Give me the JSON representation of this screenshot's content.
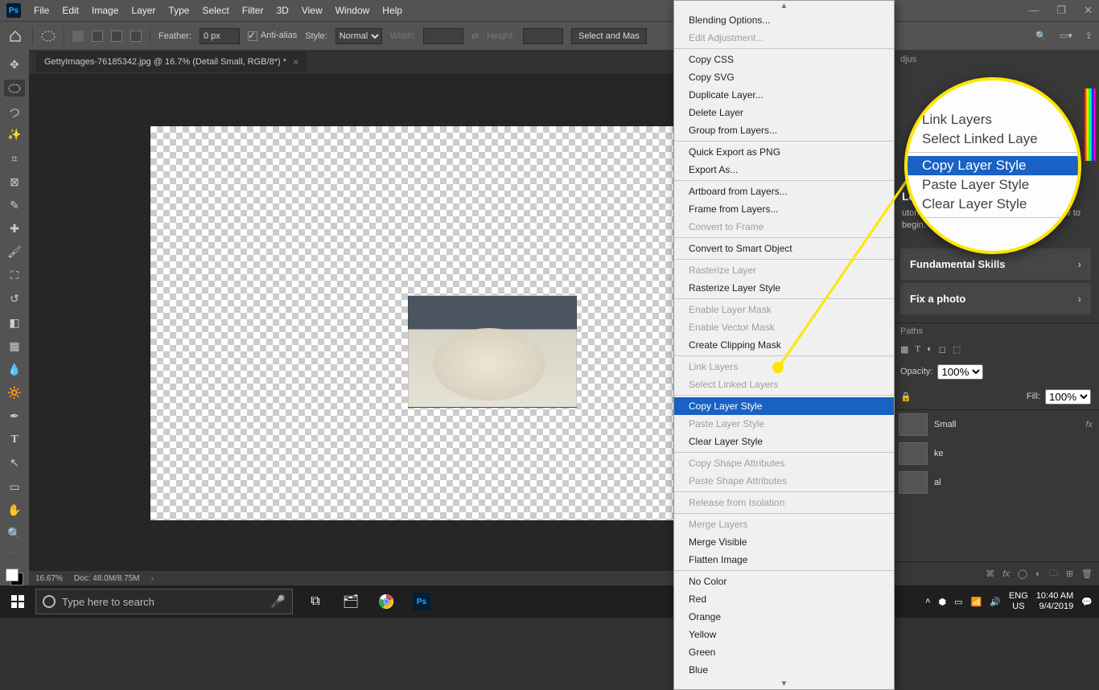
{
  "menubar": {
    "items": [
      "File",
      "Edit",
      "Image",
      "Layer",
      "Type",
      "Select",
      "Filter",
      "3D",
      "View",
      "Window",
      "Help"
    ]
  },
  "optbar": {
    "feather_label": "Feather:",
    "feather_value": "0 px",
    "antialias": "Anti-alias",
    "style_label": "Style:",
    "style_value": "Normal",
    "width_label": "Width:",
    "height_label": "Height:",
    "button": "Select and Mas"
  },
  "tab": {
    "title": "GettyImages-76185342.jpg @ 16.7% (Detail Small, RGB/8*) *"
  },
  "status": {
    "zoom": "16.67%",
    "doc": "Doc: 48.0M/8.75M"
  },
  "context": {
    "groups": [
      [
        "Blending Options...",
        "~Edit Adjustment..."
      ],
      [
        "Copy CSS",
        "Copy SVG",
        "Duplicate Layer...",
        "Delete Layer",
        "Group from Layers..."
      ],
      [
        "Quick Export as PNG",
        "Export As..."
      ],
      [
        "Artboard from Layers...",
        "Frame from Layers...",
        "~Convert to Frame"
      ],
      [
        "Convert to Smart Object"
      ],
      [
        "~Rasterize Layer",
        "Rasterize Layer Style"
      ],
      [
        "~Enable Layer Mask",
        "~Enable Vector Mask",
        "Create Clipping Mask"
      ],
      [
        "~Link Layers",
        "~Select Linked Layers"
      ],
      [
        "!Copy Layer Style",
        "~Paste Layer Style",
        "Clear Layer Style"
      ],
      [
        "~Copy Shape Attributes",
        "~Paste Shape Attributes"
      ],
      [
        "~Release from Isolation"
      ],
      [
        "~Merge Layers",
        "Merge Visible",
        "Flatten Image"
      ],
      [
        "No Color",
        "Red",
        "Orange",
        "Yellow",
        "Green",
        "Blue"
      ]
    ]
  },
  "zoom": {
    "items": [
      "Link Layers",
      "Select Linked Laye"
    ],
    "hl": "Copy Layer Style",
    "after": [
      "Paste Layer Style",
      "Clear Layer Style"
    ]
  },
  "right": {
    "adjtab": "djus",
    "learn_title": "Learn",
    "learn_body": "utorials directly in the app. Pick a pic below to begin.",
    "cards": [
      "Fundamental Skills",
      "Fix a photo"
    ],
    "paths_tab": "Paths",
    "opacity_label": "Opacity:",
    "opacity_val": "100%",
    "fill_label": "Fill:",
    "fill_val": "100%",
    "layers": [
      "Small",
      "ke",
      "al"
    ]
  },
  "taskbar": {
    "search_placeholder": "Type here to search",
    "lang1": "ENG",
    "lang2": "US",
    "time": "10:40 AM",
    "date": "9/4/2019"
  }
}
